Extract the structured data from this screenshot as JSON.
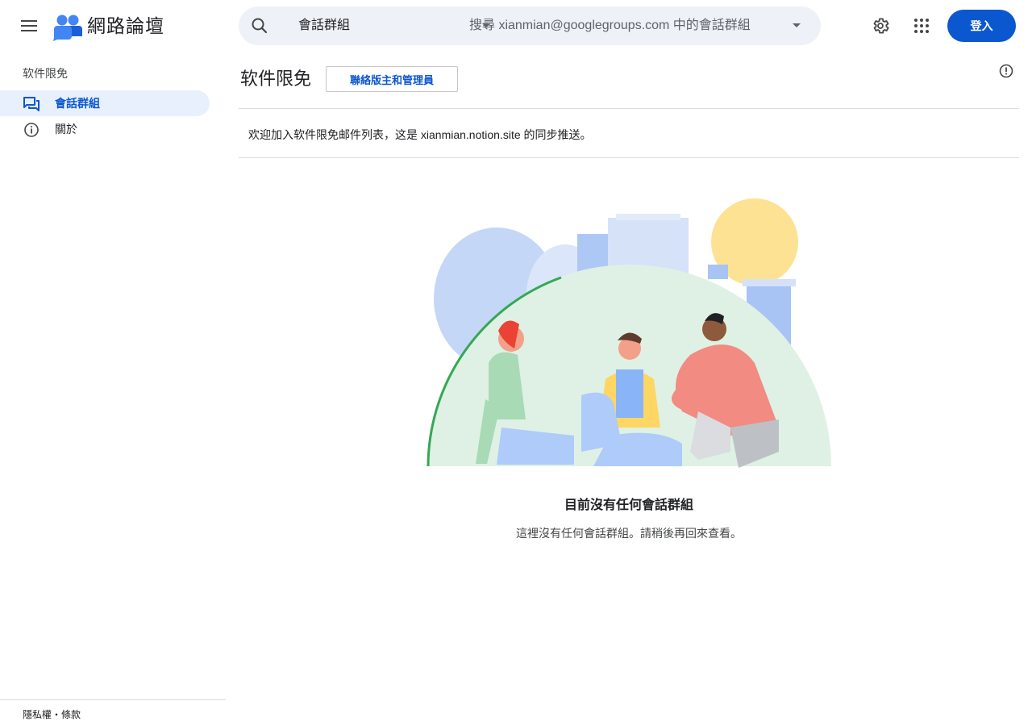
{
  "header": {
    "app_name": "網路論壇",
    "search": {
      "scope_label": "會話群組",
      "placeholder": "搜尋 xianmian@googlegroups.com 中的會話群組"
    },
    "signin_label": "登入"
  },
  "sidebar": {
    "group_title": "软件限免",
    "items": [
      {
        "label": "會話群組",
        "icon": "conversations-icon",
        "active": true
      },
      {
        "label": "關於",
        "icon": "info-icon",
        "active": false
      }
    ],
    "footer_link": "隱私權・條款"
  },
  "main": {
    "group_title": "软件限免",
    "contact_button": "聯絡版主和管理員",
    "welcome_text": "欢迎加入软件限免邮件列表，这是 xianmian.notion.site 的同步推送。",
    "empty_state": {
      "title": "目前沒有任何會話群組",
      "description": "這裡沒有任何會話群組。請稍後再回來查看。"
    }
  },
  "colors": {
    "brand_blue": "#0b57d0",
    "active_nav_bg": "#e8f0fe",
    "search_bg": "#eef2f8"
  }
}
